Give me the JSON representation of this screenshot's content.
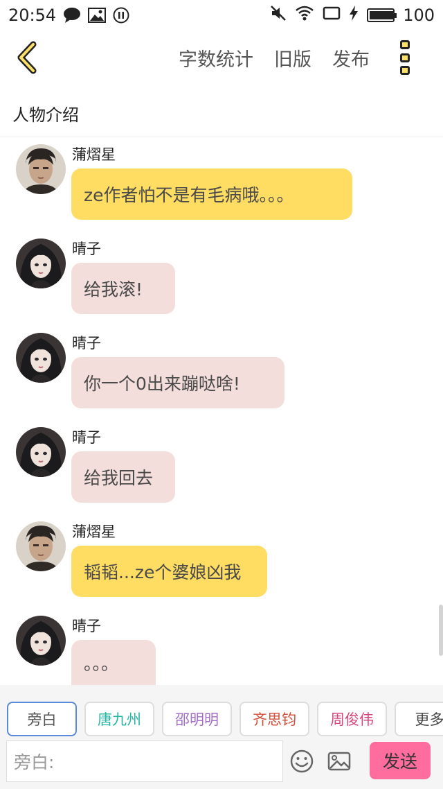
{
  "status_bar": {
    "time": "20:54",
    "battery": "100",
    "battery_level": 1.0,
    "icons": [
      "message-icon",
      "image-icon",
      "pause-icon",
      "mute-icon",
      "wifi-icon",
      "rotate-icon",
      "charging-icon",
      "battery-icon"
    ]
  },
  "header": {
    "back_icon": "chevron-left-icon",
    "actions": [
      "字数统计",
      "旧版",
      "发布"
    ],
    "more_icon": "more-vertical-icon",
    "accent": "#ffe168"
  },
  "section_title": "人物介绍",
  "messages": [
    {
      "name": "蒲熠星",
      "text": "ze作者怕不是有毛病哦。。。",
      "bubble_color": "#ffdc62",
      "avatar": "male-avatar"
    },
    {
      "name": "晴子",
      "text": "给我滚!",
      "bubble_color": "#f4dedc",
      "avatar": "female-avatar"
    },
    {
      "name": "晴子",
      "text": "你一个0出来蹦哒啥!",
      "bubble_color": "#f4dedc",
      "avatar": "female-avatar"
    },
    {
      "name": "晴子",
      "text": "给我回去",
      "bubble_color": "#f4dedc",
      "avatar": "female-avatar"
    },
    {
      "name": "蒲熠星",
      "text": "韬韬...ze个婆娘凶我",
      "bubble_color": "#ffdc62",
      "avatar": "male-avatar"
    },
    {
      "name": "晴子",
      "text": "。。。",
      "bubble_color": "#f4dedc",
      "avatar": "female-avatar"
    }
  ],
  "characters": [
    {
      "label": "旁白",
      "color": "#555555"
    },
    {
      "label": "唐九州",
      "color": "#26b7a4"
    },
    {
      "label": "邵明明",
      "color": "#a36ec8"
    },
    {
      "label": "齐思钧",
      "color": "#d2503a"
    },
    {
      "label": "周俊伟",
      "color": "#d8457b"
    },
    {
      "label": "更多",
      "color": "#444444"
    }
  ],
  "composer": {
    "placeholder": "旁白:",
    "emoji_icon": "smiley-icon",
    "image_icon": "picture-icon",
    "send_label": "发送",
    "send_color": "#ff6d9e"
  }
}
